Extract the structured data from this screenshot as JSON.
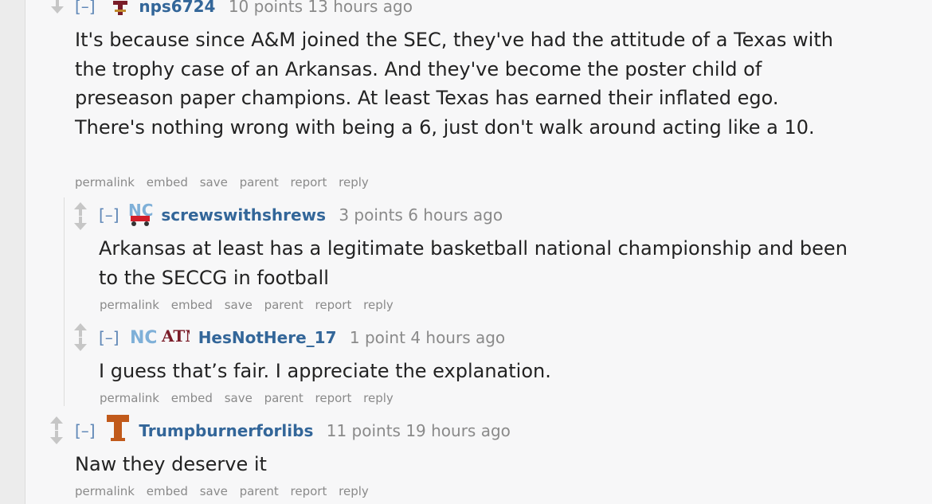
{
  "comments": [
    {
      "collapse": "[–]",
      "author": "nps6724",
      "flair": [
        "texas-am-flair-icon"
      ],
      "score": "10 points",
      "time": "13 hours ago",
      "body": "It's because since A&M joined the SEC, they've had the attitude of a Texas with the trophy case of an Arkansas. And they've become the poster child of preseason paper champions. At least Texas has earned their inflated ego. There's nothing wrong with being a 6, just don't walk around acting like a 10.",
      "buttons": [
        "permalink",
        "embed",
        "save",
        "parent",
        "report",
        "reply"
      ]
    },
    {
      "collapse": "[–]",
      "author": "screwswithshrews",
      "flair": [
        "north-carolina-wagon-flair-icon"
      ],
      "score": "3 points",
      "time": "6 hours ago",
      "body": "Arkansas at least has a legitimate basketball national championship and been to the SECCG in football",
      "buttons": [
        "permalink",
        "embed",
        "save",
        "parent",
        "report",
        "reply"
      ]
    },
    {
      "collapse": "[–]",
      "author": "HesNotHere_17",
      "flair": [
        "north-carolina-flair-icon",
        "texas-am-flair-icon"
      ],
      "score": "1 point",
      "time": "4 hours ago",
      "body": "I guess that’s fair. I appreciate the explanation.",
      "buttons": [
        "permalink",
        "embed",
        "save",
        "parent",
        "report",
        "reply"
      ]
    },
    {
      "collapse": "[–]",
      "author": "Trumpburnerforlibs",
      "flair": [
        "texas-longhorns-flair-icon"
      ],
      "score": "11 points",
      "time": "19 hours ago",
      "body": "Naw they deserve it",
      "buttons": [
        "permalink",
        "embed",
        "save",
        "parent",
        "report",
        "reply"
      ]
    }
  ],
  "colors": {
    "author": "#336699",
    "meta": "#8a8a8a",
    "texas_orange": "#c15a1b",
    "am_maroon": "#7a1c28",
    "unc_blue": "#7fb0d8"
  }
}
